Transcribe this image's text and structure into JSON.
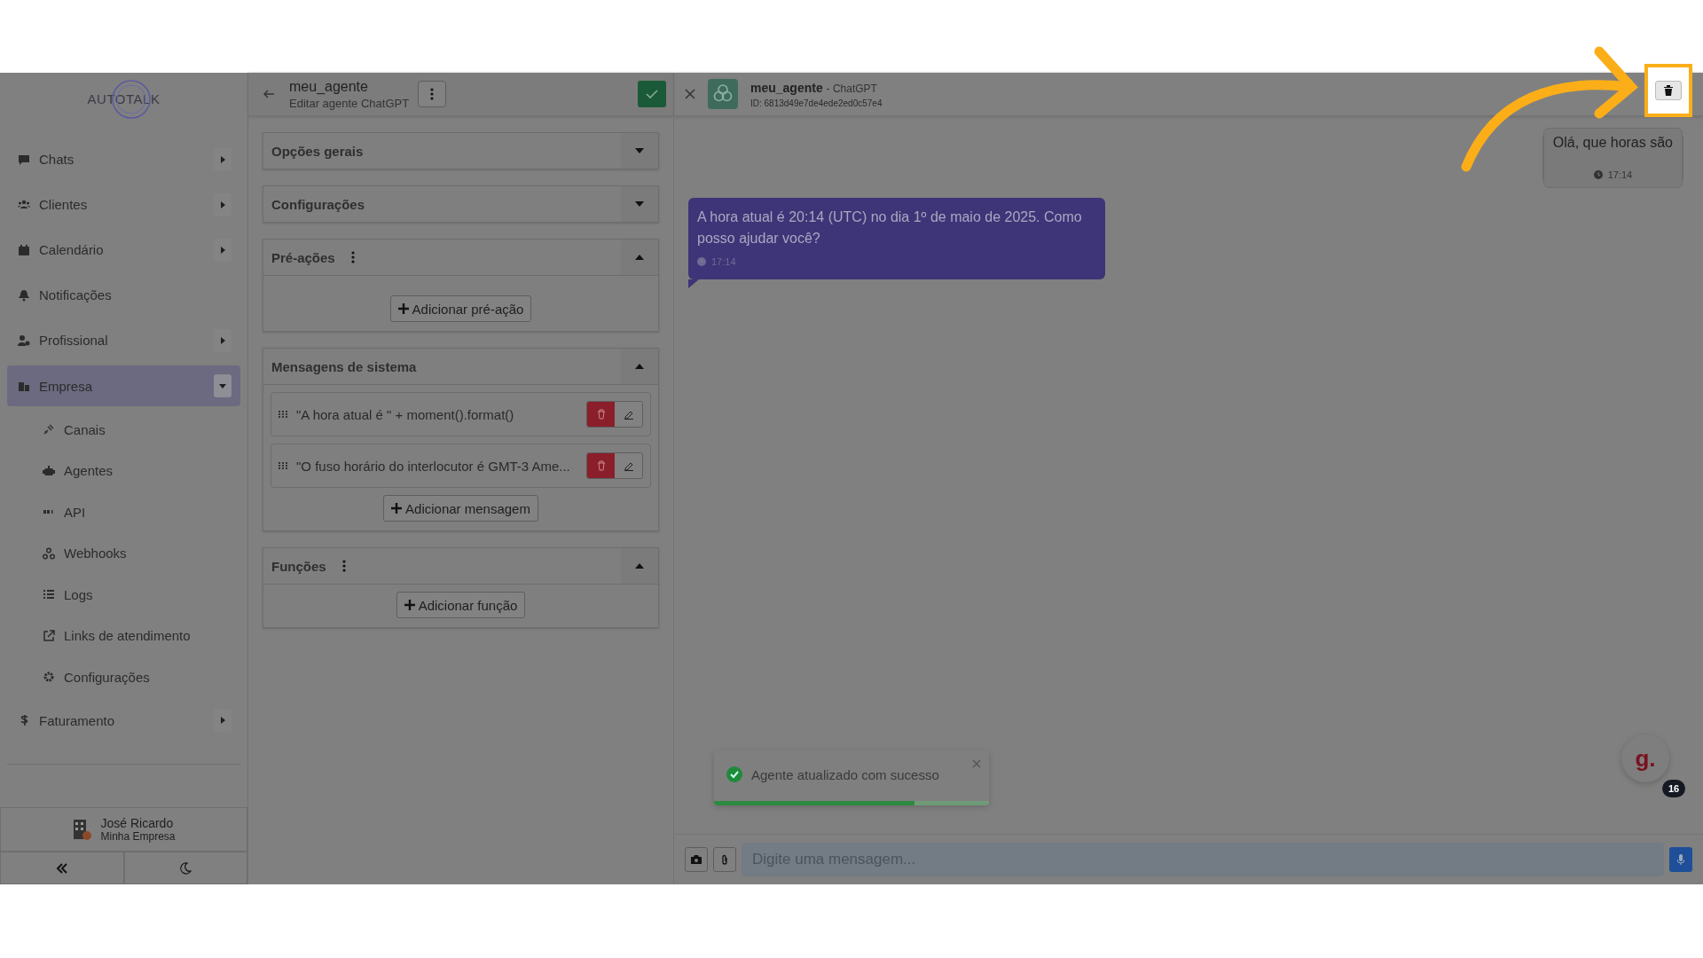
{
  "sidebar": {
    "logo": "AUTOTALK",
    "items": [
      {
        "label": "Chats",
        "kind": "group",
        "expanded": false,
        "selected": false
      },
      {
        "label": "Clientes",
        "kind": "group",
        "expanded": false,
        "selected": false
      },
      {
        "label": "Calendário",
        "kind": "group",
        "expanded": false,
        "selected": false
      },
      {
        "label": "Notificações",
        "kind": "link",
        "selected": false
      },
      {
        "label": "Profissional",
        "kind": "group",
        "expanded": false,
        "selected": false
      },
      {
        "label": "Empresa",
        "kind": "group",
        "expanded": true,
        "selected": true,
        "children": [
          {
            "label": "Canais"
          },
          {
            "label": "Agentes"
          },
          {
            "label": "API"
          },
          {
            "label": "Webhooks"
          },
          {
            "label": "Logs"
          },
          {
            "label": "Links de atendimento"
          },
          {
            "label": "Configurações"
          }
        ]
      },
      {
        "label": "Faturamento",
        "kind": "group",
        "expanded": false,
        "selected": false
      }
    ],
    "user": {
      "name": "José Ricardo",
      "company": "Minha Empresa"
    }
  },
  "editor": {
    "title": "meu_agente",
    "subtitle": "Editar agente ChatGPT",
    "sections": [
      {
        "title": "Opções gerais",
        "expanded": false,
        "has_menu": false
      },
      {
        "title": "Configurações",
        "expanded": false,
        "has_menu": false
      },
      {
        "title": "Pré-ações",
        "expanded": true,
        "has_menu": true,
        "add_button": "Adicionar pré-ação"
      },
      {
        "title": "Mensagens de sistema",
        "expanded": true,
        "has_menu": false,
        "items": [
          "\"A hora atual é \" + moment().format()",
          "\"O fuso horário do interlocutor é GMT-3 Ame..."
        ],
        "add_button": "Adicionar mensagem"
      },
      {
        "title": "Funções",
        "expanded": true,
        "has_menu": true,
        "add_button": "Adicionar função"
      }
    ]
  },
  "chat": {
    "name": "meu_agente",
    "model": "- ChatGPT",
    "id": "ID: 6813d49e7de4ede2ed0c57e4",
    "messages": [
      {
        "kind": "user",
        "text": "Olá, que horas são",
        "time": "17:14"
      },
      {
        "kind": "agent",
        "text": "A hora atual é 20:14 (UTC) no dia 1º de maio de 2025. Como posso ajudar você?",
        "time": "17:14"
      }
    ],
    "toast": {
      "text": "Agente atualizado com sucesso",
      "level": 0.73
    },
    "composer": {
      "placeholder": "Digite uma mensagem..."
    },
    "widget": {
      "logo": "g.",
      "badge": "16"
    }
  }
}
